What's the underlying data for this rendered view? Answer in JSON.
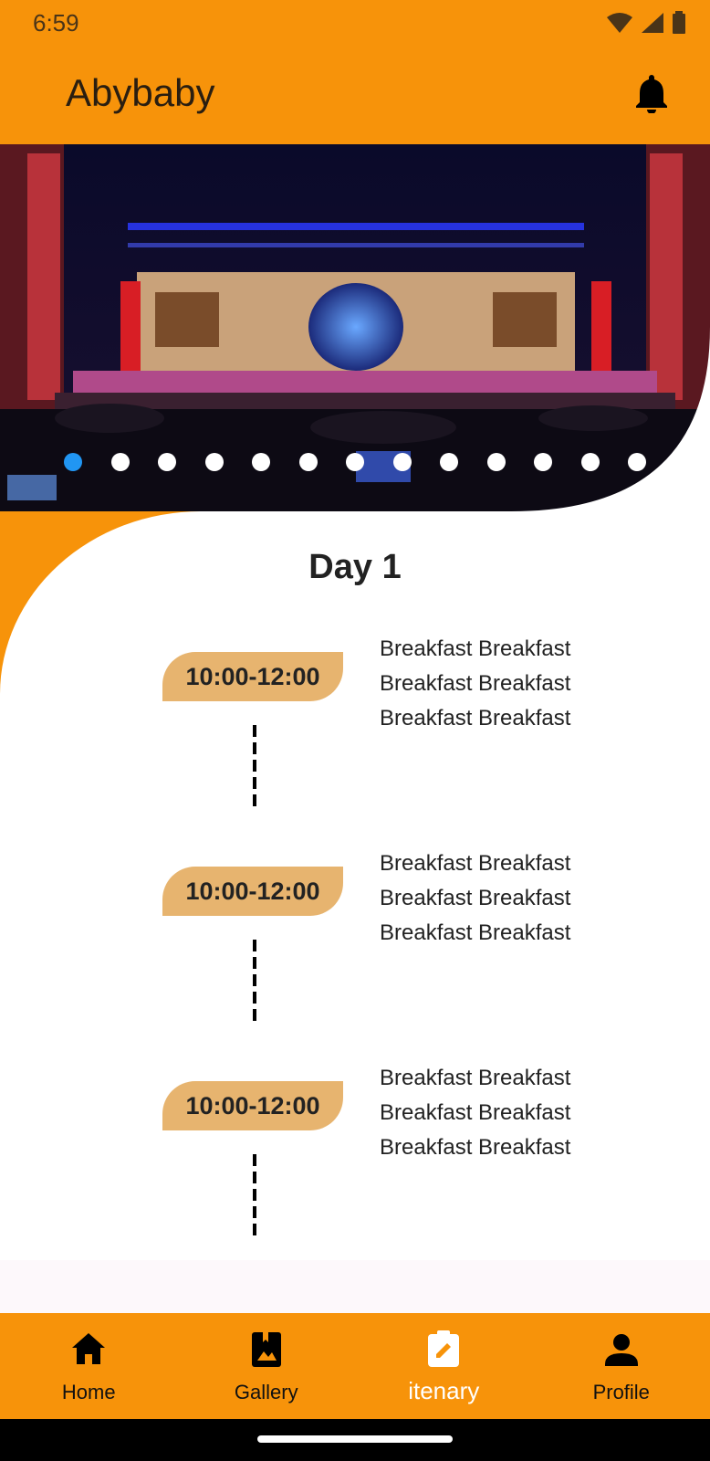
{
  "status_bar": {
    "time": "6:59"
  },
  "app_bar": {
    "title": "Abybaby"
  },
  "carousel": {
    "slide_count": 13,
    "active_index": 0
  },
  "itinerary": {
    "day_title": "Day 1",
    "entries": [
      {
        "time": "10:00-12:00",
        "lines": [
          "Breakfast Breakfast",
          "Breakfast Breakfast",
          "Breakfast Breakfast"
        ]
      },
      {
        "time": "10:00-12:00",
        "lines": [
          "Breakfast Breakfast",
          "Breakfast Breakfast",
          "Breakfast Breakfast"
        ]
      },
      {
        "time": "10:00-12:00",
        "lines": [
          "Breakfast Breakfast",
          "Breakfast Breakfast",
          "Breakfast Breakfast"
        ]
      }
    ]
  },
  "bottom_nav": {
    "items": [
      {
        "label": "Home",
        "icon": "home-icon"
      },
      {
        "label": "Gallery",
        "icon": "gallery-icon"
      },
      {
        "label": "itenary",
        "icon": "itinerary-icon"
      },
      {
        "label": "Profile",
        "icon": "profile-icon"
      }
    ],
    "active": "itenary"
  },
  "colors": {
    "primary": "#f7930a",
    "pill": "#e7b46f",
    "active_dot": "#2196f3"
  }
}
